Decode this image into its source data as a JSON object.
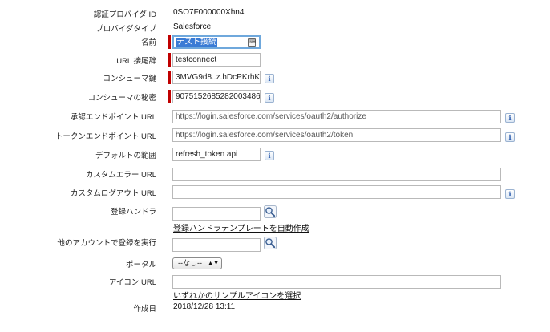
{
  "fields": {
    "provider_id": {
      "label": "認証プロバイダ ID",
      "value": "0SO7F000000Xhn4"
    },
    "provider_type": {
      "label": "プロバイダタイプ",
      "value": "Salesforce"
    },
    "name": {
      "label": "名前",
      "value": "テスト接続"
    },
    "url_suffix": {
      "label": "URL 接尾辞",
      "value": "testconnect"
    },
    "consumer_key": {
      "label": "コンシューマ鍵",
      "value": "3MVG9d8..z.hDcPKrhK"
    },
    "consumer_secret": {
      "label": "コンシューマの秘密",
      "value": "9075152685282003486"
    },
    "authorize_url": {
      "label": "承認エンドポイント URL",
      "value": "https://login.salesforce.com/services/oauth2/authorize"
    },
    "token_url": {
      "label": "トークンエンドポイント URL",
      "value": "https://login.salesforce.com/services/oauth2/token"
    },
    "default_scopes": {
      "label": "デフォルトの範囲",
      "value": "refresh_token api"
    },
    "custom_error_url": {
      "label": "カスタムエラー URL",
      "value": ""
    },
    "custom_logout_url": {
      "label": "カスタムログアウト URL",
      "value": ""
    },
    "registration_handler": {
      "label": "登録ハンドラ",
      "value": "",
      "auto_create_link": "登録ハンドラテンプレートを自動作成"
    },
    "execute_registration_as": {
      "label": "他のアカウントで登録を実行",
      "value": ""
    },
    "portal": {
      "label": "ポータル",
      "selected": "--なし--"
    },
    "icon_url": {
      "label": "アイコン URL",
      "value": "",
      "sample_link": "いずれかのサンプルアイコンを選択"
    },
    "created_date": {
      "label": "作成日",
      "value": "2018/12/28 13:11"
    }
  },
  "icons": {
    "info": "i",
    "keyboard": "⌨",
    "lookup": "magnifier-icon",
    "dropdown": "▲▼"
  },
  "colors": {
    "required_bar": "#c00000",
    "focus_border": "#6fa8dc",
    "selection": "#3a7bd5",
    "info_text": "#2255aa"
  }
}
